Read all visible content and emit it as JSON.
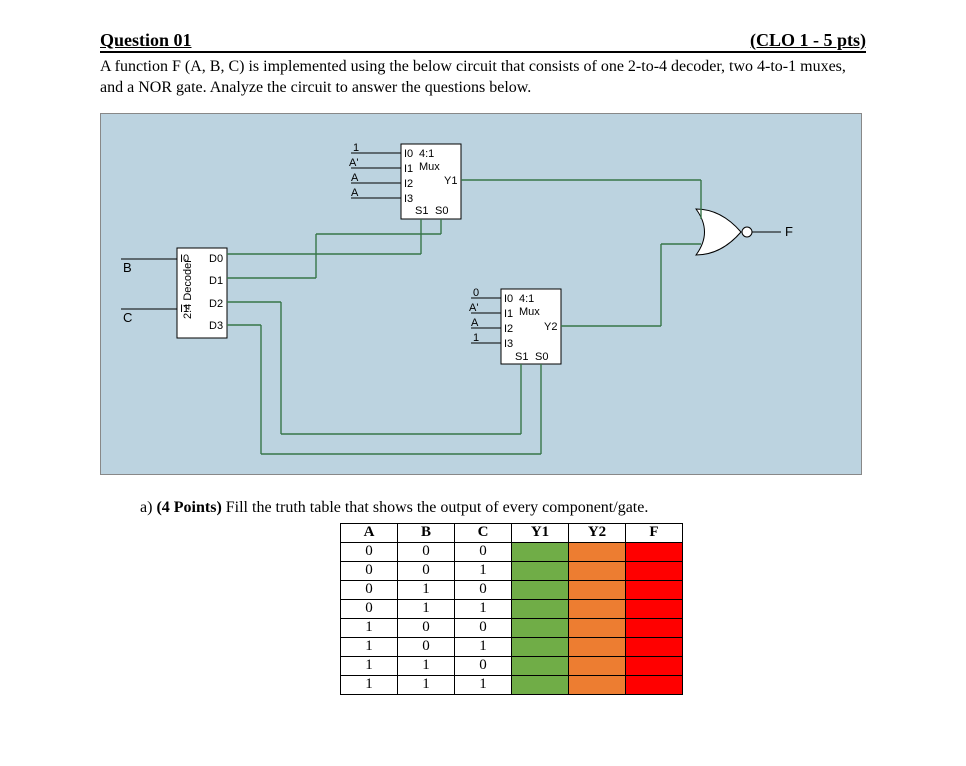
{
  "header": {
    "title": "Question 01",
    "clo": "(CLO 1 - 5 pts)"
  },
  "description": "A function F (A, B, C) is implemented using the below circuit that consists of one 2-to-4 decoder, two 4-to-1 muxes, and a NOR gate. Analyze the circuit to answer the questions below.",
  "circuit": {
    "decoder": {
      "label": "2:4 Decoder",
      "in": [
        "B",
        "C"
      ],
      "ports_in": [
        "I0",
        "I1"
      ],
      "ports_out": [
        "D0",
        "D1",
        "D2",
        "D3"
      ]
    },
    "mux1": {
      "title_top": "4:1",
      "title_bot": "Mux",
      "inputs": [
        "I0",
        "I1",
        "I2",
        "I3"
      ],
      "in_labels": [
        "1",
        "A'",
        "A",
        "A"
      ],
      "sel": [
        "S1",
        "S0"
      ],
      "out": "Y1"
    },
    "mux2": {
      "title_top": "4:1",
      "title_bot": "Mux",
      "inputs": [
        "I0",
        "I1",
        "I2",
        "I3"
      ],
      "in_labels": [
        "0",
        "A'",
        "A",
        "1"
      ],
      "sel": [
        "S1",
        "S0"
      ],
      "out": "Y2"
    },
    "output": "F"
  },
  "partA": {
    "label": "a)",
    "boldpts": "(4 Points)",
    "text": "Fill the truth table that shows the output of every component/gate."
  },
  "truth": {
    "columns": [
      "A",
      "B",
      "C",
      "Y1",
      "Y2",
      "F"
    ],
    "rows": [
      [
        "0",
        "0",
        "0",
        "",
        "",
        ""
      ],
      [
        "0",
        "0",
        "1",
        "",
        "",
        ""
      ],
      [
        "0",
        "1",
        "0",
        "",
        "",
        ""
      ],
      [
        "0",
        "1",
        "1",
        "",
        "",
        ""
      ],
      [
        "1",
        "0",
        "0",
        "",
        "",
        ""
      ],
      [
        "1",
        "0",
        "1",
        "",
        "",
        ""
      ],
      [
        "1",
        "1",
        "0",
        "",
        "",
        ""
      ],
      [
        "1",
        "1",
        "1",
        "",
        "",
        ""
      ]
    ]
  }
}
